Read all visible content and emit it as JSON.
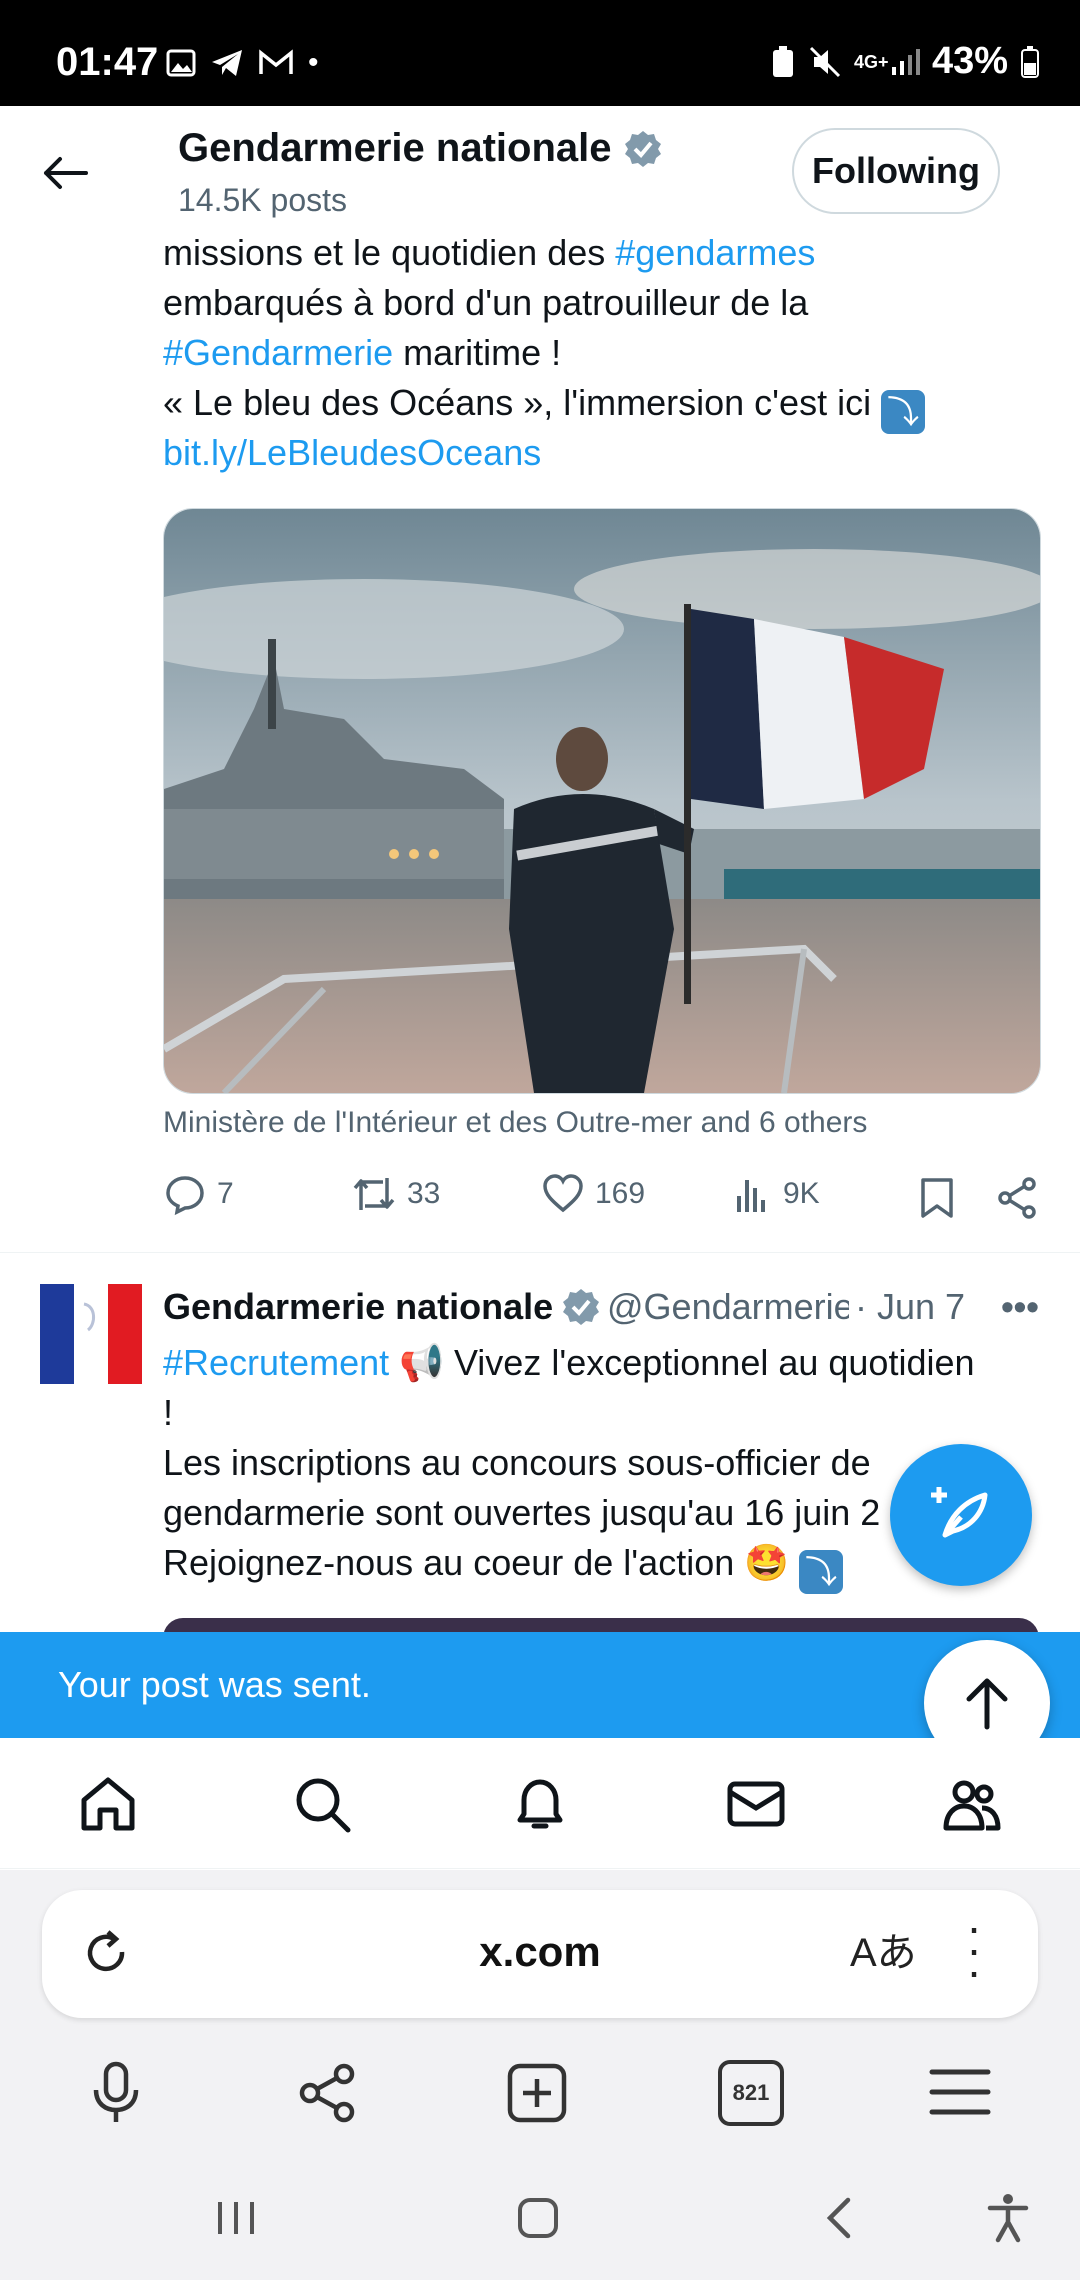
{
  "status_bar": {
    "time": "01:47",
    "battery": "43%",
    "network": "4G+"
  },
  "header": {
    "title": "Gendarmerie nationale",
    "posts_count": "14.5K posts",
    "follow_label": "Following"
  },
  "tweet1": {
    "lines": [
      {
        "parts": [
          {
            "text": "missions et le quotidien des ",
            "link": false
          },
          {
            "text": "#gendarmes",
            "link": true
          }
        ]
      },
      {
        "parts": [
          {
            "text": "embarqués à bord d'un patrouilleur de la",
            "link": false
          }
        ]
      },
      {
        "parts": [
          {
            "text": "#Gendarmerie",
            "link": true
          },
          {
            "text": " maritime !",
            "link": false
          }
        ]
      },
      {
        "parts": [
          {
            "text": "« Le bleu des Océans », l'immersion c'est ici ",
            "link": false
          }
        ]
      },
      {
        "parts": [
          {
            "text": "bit.ly/LeBleudesOceans",
            "link": true
          }
        ]
      }
    ],
    "media_caption": "Ministère de l'Intérieur et des Outre-mer and 6 others",
    "actions": {
      "replies": "7",
      "reposts": "33",
      "likes": "169",
      "views": "9K"
    }
  },
  "tweet2": {
    "author": "Gendarmerie nationale",
    "handle": "@Gendarmerie",
    "date": "· Jun 7",
    "lines": [
      {
        "parts": [
          {
            "text": "#Recrutement",
            "link": true
          },
          {
            "text": " 📢 Vivez l'exceptionnel au quotidien",
            "link": false
          }
        ]
      },
      {
        "parts": [
          {
            "text": "!",
            "link": false
          }
        ]
      },
      {
        "parts": [
          {
            "text": "Les inscriptions au concours sous-officier de",
            "link": false
          }
        ]
      },
      {
        "parts": [
          {
            "text": "gendarmerie sont ouvertes jusqu'au 16 juin 2",
            "link": false
          }
        ]
      },
      {
        "parts": [
          {
            "text": "Rejoignez-nous au coeur de l'action ",
            "link": false
          }
        ]
      }
    ]
  },
  "toast": {
    "message": "Your post was sent."
  },
  "browser": {
    "url": "x.com",
    "tabs_count": "821"
  },
  "colors": {
    "accent": "#1d9bf0",
    "text": "#0f1419",
    "secondary": "#536471"
  }
}
